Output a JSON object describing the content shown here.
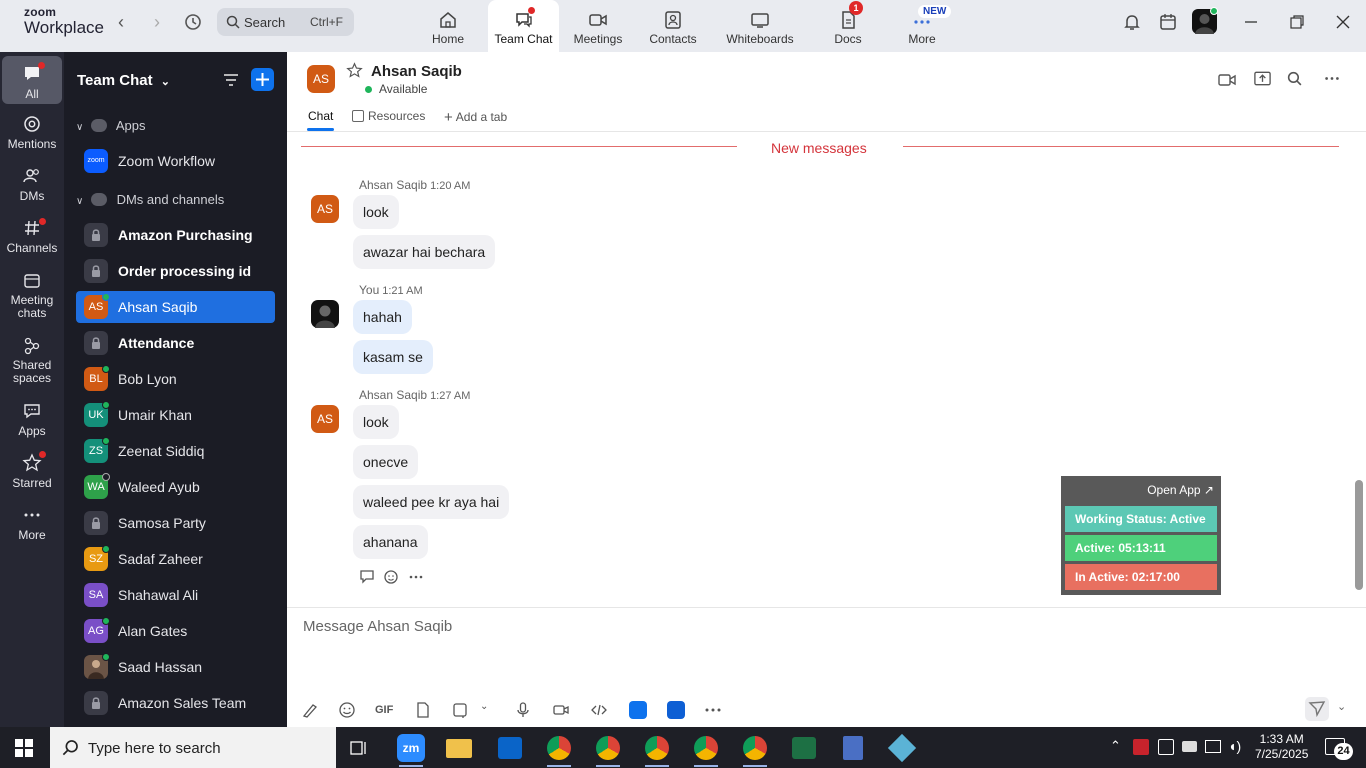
{
  "app": {
    "logo_line1": "zoom",
    "logo_line2": "Workplace",
    "search_label": "Search",
    "search_shortcut": "Ctrl+F"
  },
  "tabs": [
    {
      "label": "Home",
      "icon": "home-icon"
    },
    {
      "label": "Team Chat",
      "icon": "chat-icon"
    },
    {
      "label": "Meetings",
      "icon": "video-icon"
    },
    {
      "label": "Contacts",
      "icon": "contact-icon"
    },
    {
      "label": "Whiteboards",
      "icon": "whiteboard-icon"
    },
    {
      "label": "Docs",
      "icon": "doc-icon",
      "badge": "1"
    },
    {
      "label": "More",
      "icon": "more-icon",
      "badge": "NEW"
    }
  ],
  "rail": [
    {
      "label": "All"
    },
    {
      "label": "Mentions"
    },
    {
      "label": "DMs"
    },
    {
      "label": "Channels"
    },
    {
      "label": "Meeting chats"
    },
    {
      "label": "Shared spaces"
    },
    {
      "label": "Apps"
    },
    {
      "label": "Starred"
    },
    {
      "label": "More"
    }
  ],
  "sidebar": {
    "title": "Team Chat",
    "apps_section": "Apps",
    "dm_section": "DMs and channels",
    "workflow": {
      "label": "Zoom Workflow",
      "avatar": "zoom"
    },
    "items": [
      {
        "label": "Amazon Purchasing",
        "initials": ""
      },
      {
        "label": "Order processing id",
        "initials": ""
      },
      {
        "label": "Ahsan Saqib",
        "initials": "AS"
      },
      {
        "label": "Attendance",
        "initials": ""
      },
      {
        "label": "Bob Lyon",
        "initials": "BL"
      },
      {
        "label": "Umair Khan",
        "initials": "UK"
      },
      {
        "label": "Zeenat Siddiq",
        "initials": "ZS"
      },
      {
        "label": "Waleed Ayub",
        "initials": "WA"
      },
      {
        "label": "Samosa Party",
        "initials": ""
      },
      {
        "label": "Sadaf Zaheer",
        "initials": "SZ"
      },
      {
        "label": "Shahawal Ali",
        "initials": "SA"
      },
      {
        "label": "Alan Gates",
        "initials": "AG"
      },
      {
        "label": "Saad Hassan",
        "initials": ""
      },
      {
        "label": "Amazon Sales Team",
        "initials": ""
      }
    ]
  },
  "chat": {
    "initials": "AS",
    "name": "Ahsan Saqib",
    "status": "Available",
    "tabs": {
      "chat": "Chat",
      "resources": "Resources",
      "add": "Add a tab"
    },
    "new_messages": "New messages",
    "groups": [
      {
        "sender": "Ahsan Saqib",
        "time": "1:20 AM",
        "initials": "AS",
        "messages": [
          "look",
          "awazar hai bechara"
        ]
      },
      {
        "sender": "You",
        "time": "1:21 AM",
        "initials": "",
        "messages": [
          "hahah",
          "kasam se"
        ]
      },
      {
        "sender": "Ahsan Saqib",
        "time": "1:27 AM",
        "initials": "AS",
        "messages": [
          "look",
          "onecve",
          "waleed pee kr aya hai",
          "ahanana"
        ]
      }
    ],
    "composer_placeholder": "Message Ahsan Saqib",
    "gif_label": "GIF"
  },
  "tracker": {
    "open_app": "Open App ↗",
    "working_status": "Working Status: Active",
    "active": "Active: 05:13:11",
    "inactive": "In Active: 02:17:00"
  },
  "taskbar": {
    "search_placeholder": "Type here to search",
    "time": "1:33 AM",
    "date": "7/25/2025",
    "notifications": "24"
  },
  "colors": {
    "accent": "#0e72ed",
    "orange_avatar": "#d15a14",
    "tracker_green": "#4ed07b",
    "tracker_teal": "#5cc8b4",
    "tracker_red": "#e87060"
  }
}
